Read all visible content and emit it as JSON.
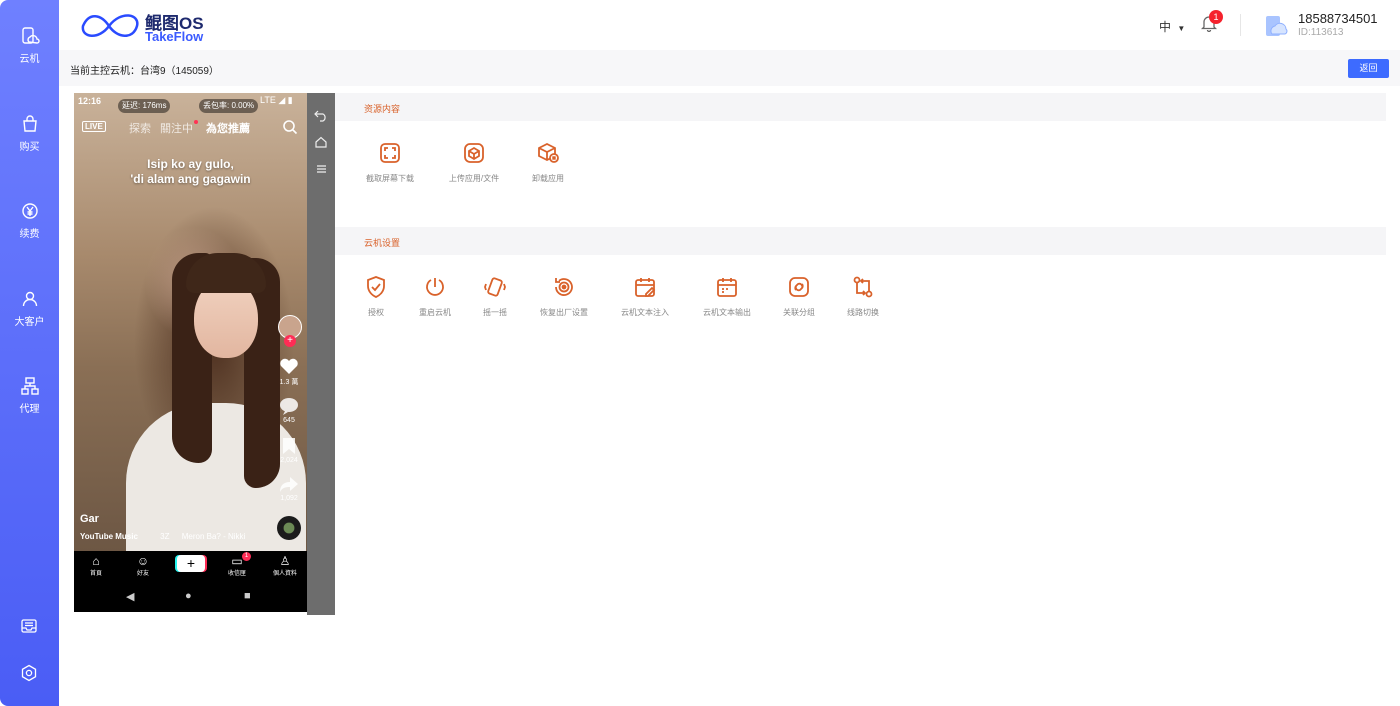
{
  "sidebar": {
    "items": [
      {
        "label": "云机",
        "icon": "cloud-phone-icon"
      },
      {
        "label": "购买",
        "icon": "shopping-bag-icon"
      },
      {
        "label": "续费",
        "icon": "yen-coin-icon"
      },
      {
        "label": "大客户",
        "icon": "user-icon"
      },
      {
        "label": "代理",
        "icon": "org-chart-icon"
      }
    ],
    "bottom_icons": [
      "message-box-icon",
      "settings-icon"
    ]
  },
  "header": {
    "brand_cn": "鲲图OS",
    "brand_en": "TakeFlow",
    "language": "中",
    "notification_count": "1",
    "user_phone": "18588734501",
    "user_id": "ID:113613"
  },
  "subbar": {
    "current_device": "当前主控云机：台湾9（145059）",
    "back_label": "返回"
  },
  "phone": {
    "time": "12:16",
    "latency": "延迟: 176ms",
    "packet_loss": "丢包率: 0.00%",
    "status_right": "LTE ◢ ▮",
    "live": "LIVE",
    "tabs": [
      "探索",
      "關注中",
      "為您推薦"
    ],
    "caption_line1": "Isip ko ay gulo,",
    "caption_line2": "'di alam ang gagawin",
    "likes": "1.3 萬",
    "comments": "645",
    "saves": "2,024",
    "shares": "1,092",
    "username": "Gar",
    "music_source": "YouTube Music",
    "music_code": "3Z",
    "music_title": "Meron Ba? - Nikki",
    "nav": [
      "首頁",
      "好友",
      "收信匣",
      "個人資料"
    ],
    "inbox_badge": "1"
  },
  "resources": {
    "title": "资源内容",
    "actions": [
      {
        "label": "截取屏幕下载",
        "icon": "screenshot-icon"
      },
      {
        "label": "上传应用/文件",
        "icon": "upload-package-icon"
      },
      {
        "label": "卸载应用",
        "icon": "uninstall-app-icon"
      }
    ]
  },
  "settings": {
    "title": "云机设置",
    "actions": [
      {
        "label": "授权",
        "icon": "shield-check-icon"
      },
      {
        "label": "重启云机",
        "icon": "power-icon"
      },
      {
        "label": "摇一摇",
        "icon": "shake-phone-icon"
      },
      {
        "label": "恢复出厂设置",
        "icon": "factory-reset-icon"
      },
      {
        "label": "云机文本注入",
        "icon": "calendar-edit-icon"
      },
      {
        "label": "云机文本输出",
        "icon": "calendar-output-icon"
      },
      {
        "label": "关联分组",
        "icon": "link-group-icon"
      },
      {
        "label": "线路切换",
        "icon": "route-switch-icon"
      }
    ]
  },
  "colors": {
    "sidebar": "#5b6ef9",
    "accent": "#d9622b",
    "primary_button": "#3d6bff"
  }
}
